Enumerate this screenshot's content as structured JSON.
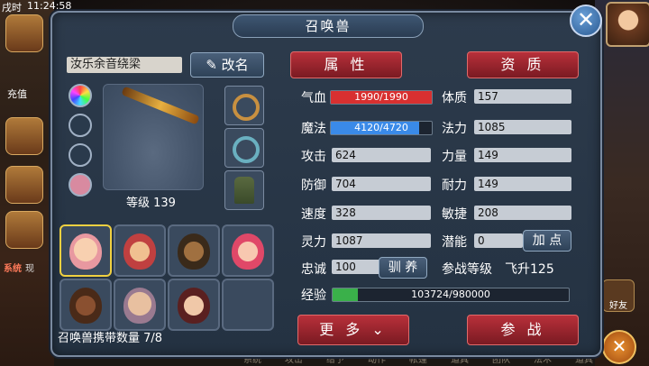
{
  "hud": {
    "time": "11:24:58",
    "period": "戌时",
    "recharge": "充值",
    "system_tag": "系统",
    "system_text": "现",
    "friend": "好友"
  },
  "bottom_menu": [
    "系统",
    "攻击",
    "给予",
    "动作",
    "帐篷",
    "道具",
    "团队",
    "法术",
    "道具"
  ],
  "dialog": {
    "title": "召唤兽",
    "close_glyph": "✕"
  },
  "pet": {
    "name": "汝乐余音绕梁",
    "rename_label": "改名",
    "level_text": "等级 139",
    "carry_count": "召唤兽携带数量 7/8"
  },
  "tabs": {
    "attributes": "属 性",
    "aptitude": "资 质"
  },
  "stats": {
    "hp_label": "气血",
    "hp_value": "1990/1990",
    "hp_fraction": 1.0,
    "mp_label": "魔法",
    "mp_value": "4120/4720",
    "mp_fraction": 0.873,
    "attack_label": "攻击",
    "attack": "624",
    "defense_label": "防御",
    "defense": "704",
    "speed_label": "速度",
    "speed": "328",
    "spirit_label": "灵力",
    "spirit": "1087",
    "loyalty_label": "忠诚",
    "loyalty": "100",
    "tame_label": "驯 养",
    "con_label": "体质",
    "con": "157",
    "mag_label": "法力",
    "mag": "1085",
    "str_label": "力量",
    "str": "149",
    "end_label": "耐力",
    "end": "149",
    "agi_label": "敏捷",
    "agi": "208",
    "potential_label": "潜能",
    "potential": "0",
    "add_points_label": "加 点",
    "battle_level_label": "参战等级",
    "battle_level": "飞升125",
    "exp_label": "经验",
    "exp_value": "103724/980000",
    "exp_fraction": 0.106
  },
  "buttons": {
    "more": "更 多",
    "more_icon": "⌄",
    "fight": "参 战"
  },
  "colors": {
    "hp": "#d83030",
    "mp": "#3a8ae8",
    "exp": "#3ab04a",
    "tab": "#9a2430"
  }
}
